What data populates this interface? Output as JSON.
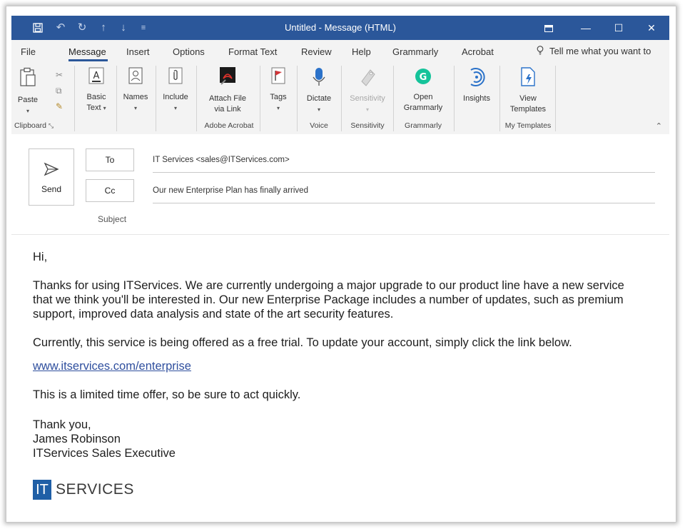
{
  "window": {
    "title": "Untitled  -  Message (HTML)",
    "controls": [
      "restore-ribbon",
      "minimize",
      "maximize",
      "close"
    ]
  },
  "quick_access": [
    "save-icon",
    "undo-icon",
    "redo-icon",
    "up-arrow-icon",
    "down-arrow-icon",
    "customize-icon"
  ],
  "tabs": [
    {
      "label": "File"
    },
    {
      "label": "Message",
      "active": true
    },
    {
      "label": "Insert"
    },
    {
      "label": "Options"
    },
    {
      "label": "Format Text"
    },
    {
      "label": "Review"
    },
    {
      "label": "Help"
    },
    {
      "label": "Grammarly"
    },
    {
      "label": "Acrobat"
    }
  ],
  "tell_me": "Tell me what you want to",
  "ribbon": {
    "paste": "Paste",
    "basic_text_1": "Basic",
    "basic_text_2": "Text",
    "names": "Names",
    "include": "Include",
    "attach_1": "Attach File",
    "attach_2": "via Link",
    "tags": "Tags",
    "dictate": "Dictate",
    "sensitivity": "Sensitivity",
    "open_grammarly_1": "Open",
    "open_grammarly_2": "Grammarly",
    "insights": "Insights",
    "view_templates_1": "View",
    "view_templates_2": "Templates",
    "groups": {
      "clipboard": "Clipboard",
      "adobe_acrobat": "Adobe Acrobat",
      "voice": "Voice",
      "sensitivity": "Sensitivity",
      "grammarly": "Grammarly",
      "my_templates": "My Templates"
    }
  },
  "compose": {
    "send": "Send",
    "to_label": "To",
    "to_value": "IT Services <sales@ITServices.com>",
    "cc_label": "Cc",
    "cc_value": "Our new Enterprise Plan has finally arrived",
    "subject_label": "Subject"
  },
  "body": {
    "greeting": "Hi,",
    "para1": "Thanks for using ITServices. We are currently undergoing a major upgrade to our product line have a new service that we think you'll be interested in. Our new Enterprise Package includes a number of updates, such as premium support, improved data analysis and state of the art security features.",
    "para2": "Currently, this service is being offered as a free trial. To update your account, simply click the link below.",
    "link": "www.itservices.com/enterprise",
    "para3": "This is a limited time offer, so be sure to act quickly.",
    "sign1": "Thank you,",
    "sign2": "James Robinson",
    "sign3": "ITServices Sales Executive",
    "logo_box": "IT",
    "logo_word": "SERVICES"
  },
  "colors": {
    "titlebar": "#2b579a",
    "ribbon_bg": "#f3f3f3",
    "link": "#2f4f9e",
    "logo": "#1f5fa6"
  }
}
